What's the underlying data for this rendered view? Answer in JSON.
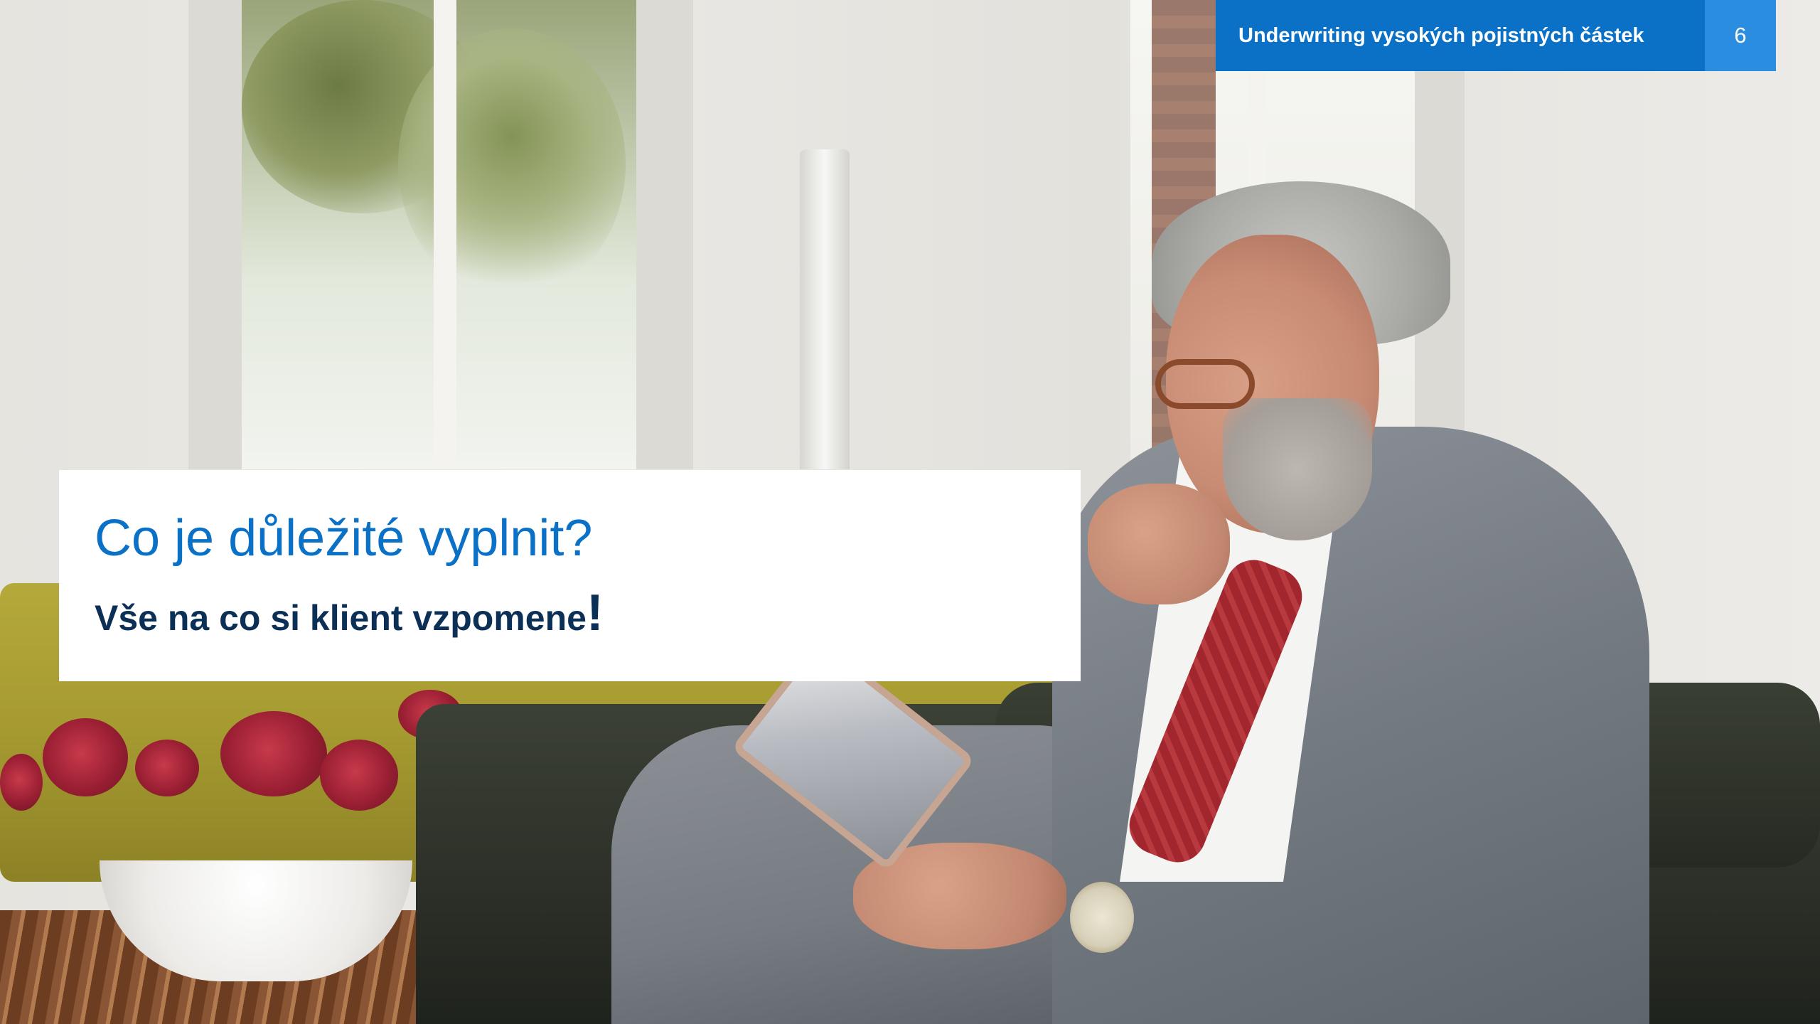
{
  "header": {
    "title": "Underwriting vysokých pojistných částek",
    "page_number": "6",
    "accent_color": "#0a71c7",
    "page_box_color": "#2b8de0"
  },
  "main": {
    "heading": "Co je důležité vyplnit?",
    "subheading": "Vše na co si klient vzpomene",
    "subheading_end": "!",
    "heading_color": "#0a71c7",
    "subheading_color": "#0c2f55"
  }
}
